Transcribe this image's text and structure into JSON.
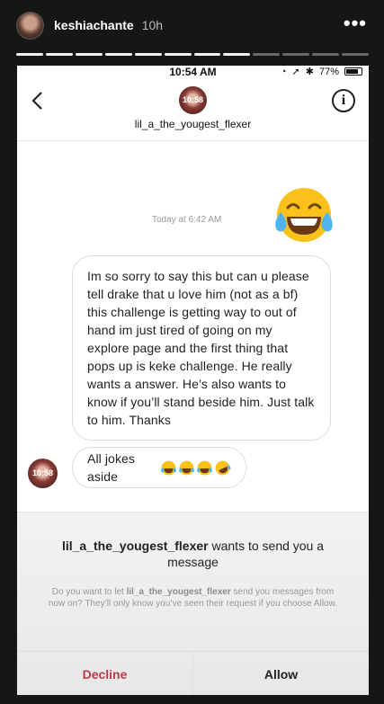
{
  "story": {
    "username": "keshiachante",
    "time_ago": "10h",
    "more_icon": "more-horizontal-icon",
    "segments_total": 12,
    "segments_done": 8
  },
  "status_bar": {
    "time": "10:54 AM",
    "battery": "77%"
  },
  "thread": {
    "username": "lil_a_the_yougest_flexer",
    "avatar_text": "10:58",
    "timestamp": "Today at 6:42 AM",
    "messages": [
      {
        "text": "Im so sorry to say this but can u please tell drake that u love him (not as a bf) this challenge is getting way to out of hand im just tired of going on my explore page and the first thing that pops up is keke challenge. He really wants a answer. He’s also wants to know if you’ll stand beside him. Just talk to him. Thanks"
      },
      {
        "text": "All jokes aside"
      }
    ],
    "emoji_reactions": [
      "face-with-tears-of-joy",
      "face-with-tears-of-joy",
      "face-with-tears-of-joy",
      "rolling-on-floor-laughing"
    ]
  },
  "request": {
    "username": "lil_a_the_yougest_flexer",
    "title_rest": " wants to send you a message",
    "body_pre": "Do you want to let ",
    "body_user": "lil_a_the_yougest_flexer",
    "body_post": " send you messages from now on? They’ll only know you’ve seen their request if you choose Allow.",
    "decline_label": "Decline",
    "allow_label": "Allow"
  },
  "colors": {
    "decline": "#c0394a",
    "emoji_yellow": "#fcc21b",
    "tear_blue": "#4fb4f0"
  }
}
